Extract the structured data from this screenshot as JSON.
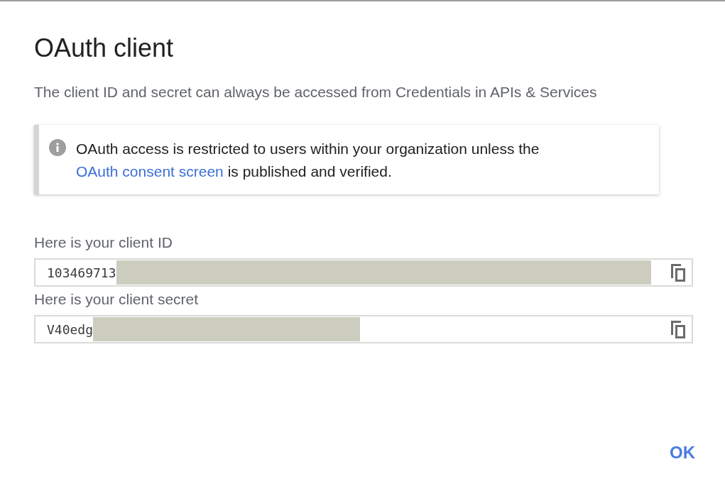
{
  "dialog": {
    "title": "OAuth client",
    "description": "The client ID and secret can always be accessed from Credentials in APIs & Services"
  },
  "notice": {
    "text_before": "OAuth access is restricted to users within your organization unless the",
    "link": "OAuth consent screen",
    "text_after": "is published and verified."
  },
  "fields": [
    {
      "label": "Here is your client ID",
      "value": "103469713"
    },
    {
      "label": "Here is your client secret",
      "value": "V40edg"
    }
  ],
  "buttons": [
    {
      "label": "OK"
    }
  ]
}
